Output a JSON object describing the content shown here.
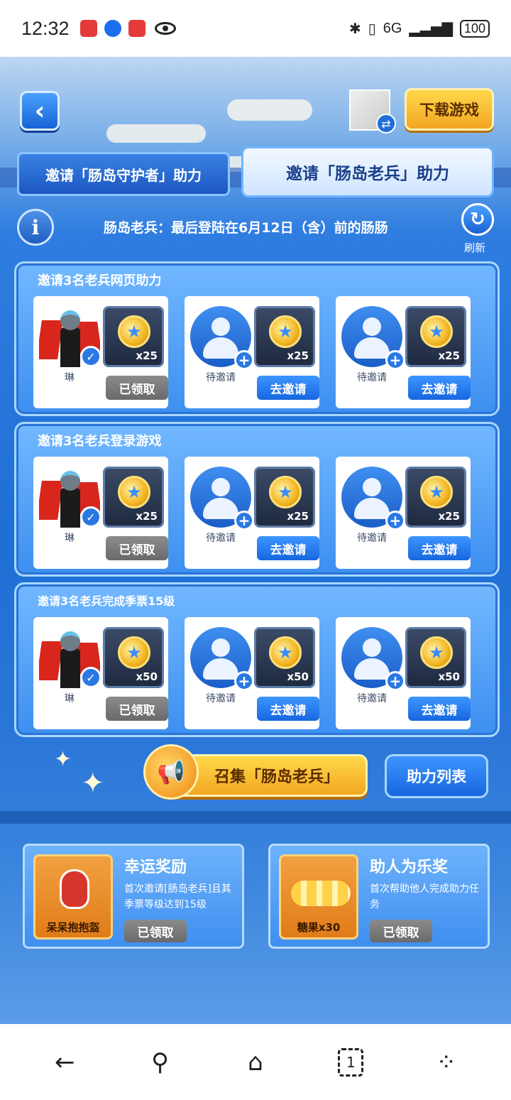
{
  "status_bar": {
    "time": "12:32",
    "signal": "6G",
    "battery": "100"
  },
  "header": {
    "back_icon": "chevron-left-icon",
    "download_label": "下载游戏",
    "switch_icon": "swap-icon"
  },
  "tabs": [
    {
      "label": "邀请「肠岛守护者」助力",
      "active": false
    },
    {
      "label": "邀请「肠岛老兵」助力",
      "active": true
    }
  ],
  "info_bar": {
    "info_icon": "info-icon",
    "text": "肠岛老兵：最后登陆在6月12日（含）前的肠肠",
    "refresh_label": "刷新"
  },
  "tasks": [
    {
      "title": "邀请3名老兵网页助力",
      "slots": [
        {
          "name": "琳",
          "status": "done",
          "reward": "x25",
          "button": "已领取"
        },
        {
          "name": "待邀请",
          "status": "pending",
          "reward": "x25",
          "button": "去邀请"
        },
        {
          "name": "待邀请",
          "status": "pending",
          "reward": "x25",
          "button": "去邀请"
        }
      ]
    },
    {
      "title": "邀请3名老兵登录游戏",
      "slots": [
        {
          "name": "琳",
          "status": "done",
          "reward": "x25",
          "button": "已领取"
        },
        {
          "name": "待邀请",
          "status": "pending",
          "reward": "x25",
          "button": "去邀请"
        },
        {
          "name": "待邀请",
          "status": "pending",
          "reward": "x25",
          "button": "去邀请"
        }
      ]
    },
    {
      "title": "邀请3名老兵完成季票15级",
      "slots": [
        {
          "name": "琳",
          "status": "done",
          "reward": "x50",
          "button": "已领取"
        },
        {
          "name": "待邀请",
          "status": "pending",
          "reward": "x50",
          "button": "去邀请"
        },
        {
          "name": "待邀请",
          "status": "pending",
          "reward": "x50",
          "button": "去邀请"
        }
      ]
    }
  ],
  "actions": {
    "summon_label": "召集「肠岛老兵」",
    "assist_list_label": "助力列表"
  },
  "bonuses": [
    {
      "title": "幸运奖励",
      "desc": "首次邀请[肠岛老兵]且其季票等级达到15级",
      "item_label": "呆呆抱抱盔",
      "button": "已领取"
    },
    {
      "title": "助人为乐奖",
      "desc": "首次帮助他人完成助力任务",
      "item_label": "糖果x30",
      "button": "已领取"
    }
  ],
  "colors": {
    "accent_blue": "#1e6fd6",
    "gold": "#f2a623",
    "claimed_gray": "#7a7a7a"
  }
}
